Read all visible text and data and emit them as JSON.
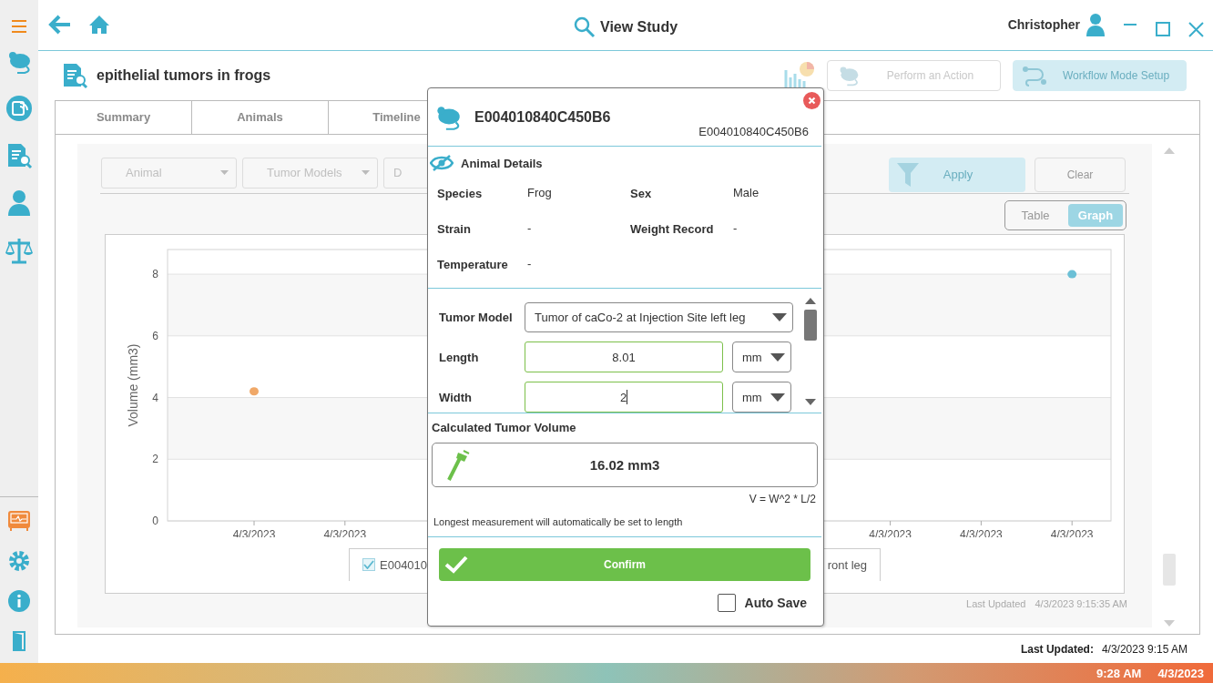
{
  "window": {
    "title": "View Study",
    "user": "Christopher"
  },
  "study": {
    "title": "epithelial tumors in frogs"
  },
  "actions": [
    {
      "kind": "outline",
      "label": "Perform an Action",
      "disabled": true
    },
    {
      "kind": "filled",
      "label": "Workflow Mode Setup",
      "disabled": true
    }
  ],
  "tabs": [
    {
      "label": "Summary",
      "selected": false
    },
    {
      "label": "Animals",
      "selected": false
    },
    {
      "label": "Timeline",
      "selected": false
    }
  ],
  "filters": {
    "dropdowns": [
      {
        "label": "Animal",
        "disabled": true
      },
      {
        "label": "Tumor Models",
        "disabled": true
      },
      {
        "label": "D",
        "disabled": true
      }
    ],
    "apply": {
      "label": "Apply",
      "disabled": true
    },
    "clear": {
      "label": "Clear",
      "disabled": true
    }
  },
  "view_toggle": [
    {
      "label": "Table",
      "selected": false
    },
    {
      "label": "Graph",
      "selected": true
    }
  ],
  "chart": {
    "chart_data": {
      "type": "scatter",
      "grid": true,
      "ylabel": "Volume (mm3)",
      "ylim": [
        0,
        8.8
      ],
      "yticks": [
        0,
        2,
        4,
        6,
        8
      ],
      "categories": [
        "4/3/2023",
        "4/3/2023",
        null,
        null,
        null,
        null,
        null,
        "4/3/2023",
        "4/3/2023",
        "4/3/2023"
      ],
      "series": [
        {
          "color": "#f0a868",
          "values": [
            4.2,
            null,
            null,
            null,
            null,
            null,
            null,
            null,
            null,
            null
          ]
        },
        {
          "color": "#6cc0d6",
          "values": [
            null,
            null,
            null,
            null,
            null,
            null,
            null,
            null,
            null,
            8
          ]
        }
      ]
    },
    "legend": {
      "checked": true,
      "text_start": "E004010",
      "text_end": "ront leg"
    }
  },
  "pane_updated": {
    "label": "Last Updated",
    "value": "4/3/2023 9:15:35 AM"
  },
  "dialog": {
    "title": "E004010840C450B6",
    "subtitle": "E004010840C450B6",
    "section": "Animal Details",
    "details": [
      {
        "label": "Species",
        "value": "Frog"
      },
      {
        "label": "Sex",
        "value": "Male"
      },
      {
        "label": "Strain",
        "value": "-"
      },
      {
        "label": "Weight Record",
        "value": "-"
      },
      {
        "label": "Temperature",
        "value": "-"
      }
    ],
    "measurements": [
      {
        "kind": "select",
        "label": "Tumor Model",
        "value": "Tumor of caCo-2 at Injection Site left leg"
      },
      {
        "kind": "number",
        "label": "Length",
        "value": "8.01",
        "unit": "mm"
      },
      {
        "kind": "number",
        "label": "Width",
        "value": "2",
        "unit": "mm"
      }
    ],
    "volume_label": "Calculated Tumor Volume",
    "volume": "16.02 mm3",
    "formula": "V = W^2 * L/2",
    "note": "Longest measurement will automatically be set to length",
    "confirm": "Confirm",
    "auto_save": {
      "label": "Auto Save",
      "checked": false
    }
  },
  "footer": {
    "label": "Last Updated:",
    "value": "4/3/2023 9:15 AM"
  },
  "taskbar": {
    "time": "9:28 AM",
    "date": "4/3/2023"
  }
}
